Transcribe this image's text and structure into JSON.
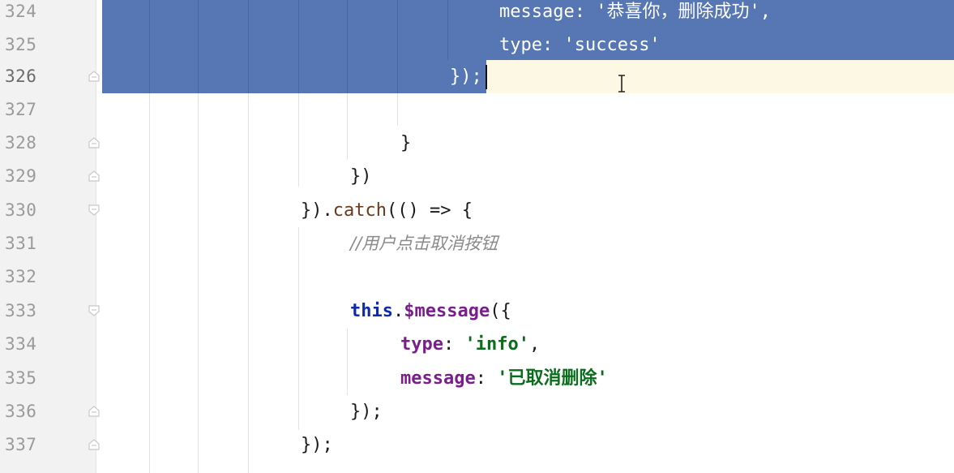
{
  "editor": {
    "lines": [
      {
        "num": "324",
        "tokens": [
          {
            "t": "message",
            "c": "onsel"
          },
          {
            "t": ": '恭喜你，删除成功',",
            "c": "onsel"
          }
        ]
      },
      {
        "num": "325",
        "tokens": [
          {
            "t": "type",
            "c": "onsel"
          },
          {
            "t": ": 'success'",
            "c": "onsel"
          }
        ]
      },
      {
        "num": "326",
        "tokens": [
          {
            "t": "});",
            "c": "onsel"
          }
        ]
      },
      {
        "num": "327",
        "tokens": []
      },
      {
        "num": "328",
        "tokens": [
          {
            "t": "}",
            "c": "plain"
          }
        ]
      },
      {
        "num": "329",
        "tokens": [
          {
            "t": "})",
            "c": "plain"
          }
        ]
      },
      {
        "num": "330",
        "tokens": [
          {
            "t": "}).",
            "c": "plain"
          },
          {
            "t": "catch",
            "c": "func"
          },
          {
            "t": "(() => {",
            "c": "plain"
          }
        ]
      },
      {
        "num": "331",
        "tokens": [
          {
            "t": "//用户点击取消按钮",
            "c": "cmt"
          }
        ]
      },
      {
        "num": "332",
        "tokens": []
      },
      {
        "num": "333",
        "tokens": [
          {
            "t": "this",
            "c": "kw"
          },
          {
            "t": ".",
            "c": "plain"
          },
          {
            "t": "$message",
            "c": "prop"
          },
          {
            "t": "({",
            "c": "plain"
          }
        ]
      },
      {
        "num": "334",
        "tokens": [
          {
            "t": "type",
            "c": "prop"
          },
          {
            "t": ": ",
            "c": "plain"
          },
          {
            "t": "'info'",
            "c": "str"
          },
          {
            "t": ",",
            "c": "plain"
          }
        ]
      },
      {
        "num": "335",
        "tokens": [
          {
            "t": "message",
            "c": "prop"
          },
          {
            "t": ": ",
            "c": "plain"
          },
          {
            "t": "'已取消删除'",
            "c": "str"
          }
        ]
      },
      {
        "num": "336",
        "tokens": [
          {
            "t": "});",
            "c": "plain"
          }
        ]
      },
      {
        "num": "337",
        "tokens": [
          {
            "t": "});",
            "c": "plain"
          }
        ]
      }
    ]
  }
}
